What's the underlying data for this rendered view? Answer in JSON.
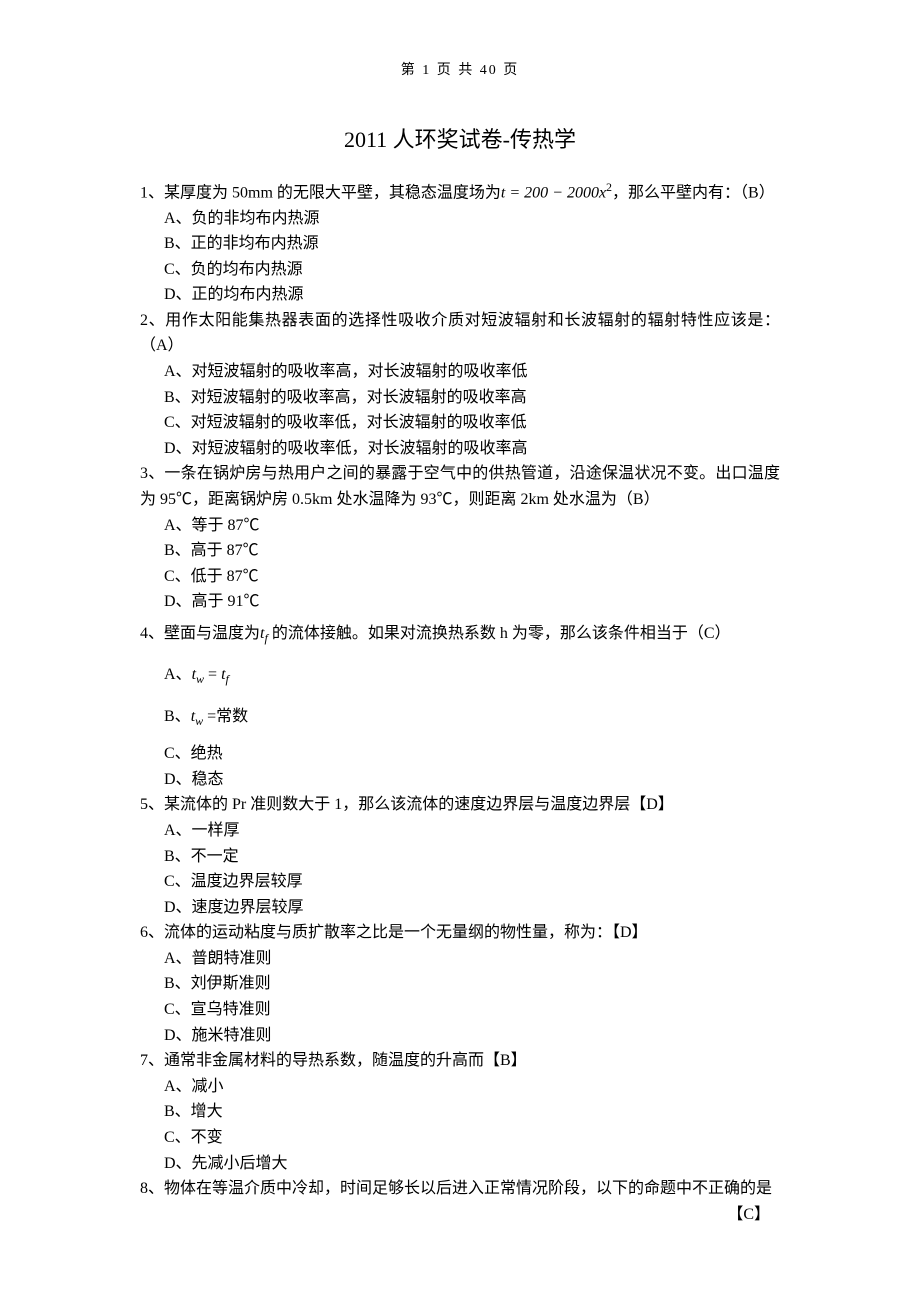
{
  "header": {
    "pagination": "第 1 页 共 40 页"
  },
  "title": "2011 人环奖试卷-传热学",
  "questions": [
    {
      "stem_prefix": "1、某厚度为 50mm 的无限大平壁，其稳态温度场为",
      "equation": "t = 200 − 2000x",
      "sup": "2",
      "stem_suffix": "，那么平壁内有：（B）",
      "options": [
        "A、负的非均布内热源",
        "B、正的非均布内热源",
        "C、负的均布内热源",
        "D、正的均布内热源"
      ]
    },
    {
      "stem": "2、用作太阳能集热器表面的选择性吸收介质对短波辐射和长波辐射的辐射特性应该是：（A）",
      "options": [
        "A、对短波辐射的吸收率高，对长波辐射的吸收率低",
        "B、对短波辐射的吸收率高，对长波辐射的吸收率高",
        "C、对短波辐射的吸收率低，对长波辐射的吸收率低",
        "D、对短波辐射的吸收率低，对长波辐射的吸收率高"
      ]
    },
    {
      "stem": "3、一条在锅炉房与热用户之间的暴露于空气中的供热管道，沿途保温状况不变。出口温度为 95℃，距离锅炉房 0.5km 处水温降为 93℃，则距离 2km 处水温为（B）",
      "options": [
        "A、等于 87℃",
        "B、高于 87℃",
        "C、低于 87℃",
        "D、高于 91℃"
      ]
    },
    {
      "stem_prefix": "4、壁面与温度为",
      "var1": "t",
      "sub1": "f",
      "stem_suffix": " 的流体接触。如果对流换热系数 h 为零，那么该条件相当于（C）",
      "options_special": [
        {
          "label": "A、",
          "var": "t",
          "sub_a": "w",
          "eq": " = ",
          "var2": "t",
          "sub_b": "f"
        },
        {
          "label": "B、",
          "var": "t",
          "sub_a": "w",
          "eq": " =常数"
        }
      ],
      "options": [
        "C、绝热",
        "D、稳态"
      ]
    },
    {
      "stem": "5、某流体的 Pr 准则数大于 1，那么该流体的速度边界层与温度边界层【D】",
      "options": [
        "A、一样厚",
        "B、不一定",
        "C、温度边界层较厚",
        "D、速度边界层较厚"
      ]
    },
    {
      "stem": "6、流体的运动粘度与质扩散率之比是一个无量纲的物性量，称为：【D】",
      "options": [
        "A、普朗特准则",
        "B、刘伊斯准则",
        "C、宣乌特准则",
        "D、施米特准则"
      ]
    },
    {
      "stem": "7、通常非金属材料的导热系数，随温度的升高而【B】",
      "options": [
        "A、减小",
        "B、增大",
        "C、不变",
        "D、先减小后增大"
      ]
    },
    {
      "stem": "8、物体在等温介质中冷却，时间足够长以后进入正常情况阶段，以下的命题中不正确的是",
      "answer": "【C】"
    }
  ]
}
